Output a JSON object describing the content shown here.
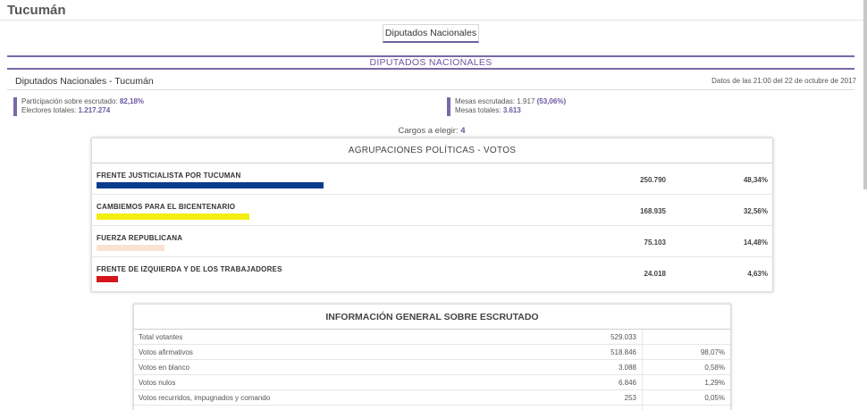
{
  "page": {
    "province_title": "Tucumán"
  },
  "tabs": [
    {
      "label": "Diputados Nacionales"
    }
  ],
  "section": {
    "title": "DIPUTADOS NACIONALES"
  },
  "subheader": {
    "title": "Diputados Nacionales - Tucumán",
    "date": "Datos de las 21:00 del 22 de octubre de 2017"
  },
  "stats": {
    "participation_label": "Participación sobre escrutado:",
    "participation_value": "82,18%",
    "electors_label": "Electores totales:",
    "electors_value": "1.217.274",
    "tables_counted_label": "Mesas escrutadas:",
    "tables_counted_value": "1.917",
    "tables_counted_pct": "(53,06%)",
    "tables_total_label": "Mesas totales:",
    "tables_total_value": "3.613"
  },
  "cargos": {
    "label": "Cargos a elegir:",
    "value": "4"
  },
  "votes_panel": {
    "title": "AGRUPACIONES POLÍTICAS - VOTOS",
    "parties": [
      {
        "name": "FRENTE JUSTICIALISTA POR TUCUMAN",
        "votes": "250.790",
        "pct": "48,34%",
        "share": 0.4834,
        "color": "#0a3c8c"
      },
      {
        "name": "CAMBIEMOS PARA EL BICENTENARIO",
        "votes": "168.935",
        "pct": "32,56%",
        "share": 0.3256,
        "color": "#f2ee12"
      },
      {
        "name": "FUERZA REPUBLICANA",
        "votes": "75.103",
        "pct": "14,48%",
        "share": 0.1448,
        "color": "#fbe3d4"
      },
      {
        "name": "FRENTE DE IZQUIERDA Y DE LOS TRABAJADORES",
        "votes": "24.018",
        "pct": "4,63%",
        "share": 0.0463,
        "color": "#d4161c"
      }
    ]
  },
  "info_panel": {
    "title": "INFORMACIÓN GENERAL SOBRE ESCRUTADO",
    "rows": [
      {
        "label": "Total votantes",
        "value": "529.033",
        "pct": ""
      },
      {
        "label": "Votos afirmativos",
        "value": "518.846",
        "pct": "98,07%"
      },
      {
        "label": "Votos en blanco",
        "value": "3.088",
        "pct": "0,58%"
      },
      {
        "label": "Votos nulos",
        "value": "6.846",
        "pct": "1,29%"
      },
      {
        "label": "Votos recurridos, impugnados y comando",
        "value": "253",
        "pct": "0,05%"
      }
    ]
  }
}
